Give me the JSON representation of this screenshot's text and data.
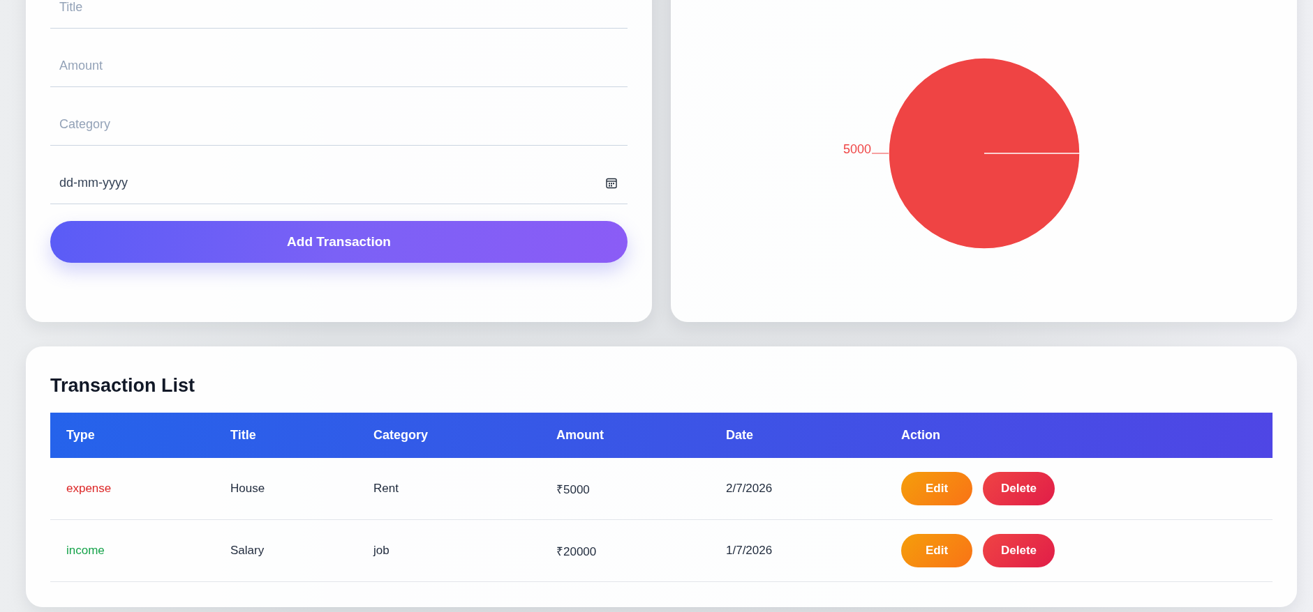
{
  "form": {
    "fields": [
      {
        "kind": "text",
        "placeholder": "Title"
      },
      {
        "kind": "text",
        "placeholder": "Amount"
      },
      {
        "kind": "text",
        "placeholder": "Category"
      },
      {
        "kind": "date",
        "placeholder": "dd-mm-yyyy"
      }
    ],
    "submit": "Add Transaction"
  },
  "chart": {
    "chart_data": {
      "type": "pie",
      "series": [
        {
          "color": "#ef4444",
          "values": [
            5000
          ]
        }
      ],
      "data_labels": true
    }
  },
  "table": {
    "title": "Transaction List",
    "columns": [
      "Type",
      "Title",
      "Category",
      "Amount",
      "Date",
      "Action"
    ],
    "rows": [
      {
        "type": "expense",
        "color": "#dc2626",
        "title": "House",
        "category": "Rent",
        "amount": "₹5000",
        "date": "2/7/2026",
        "actions": [
          {
            "kind": "edit",
            "label": "Edit"
          },
          {
            "kind": "delete",
            "label": "Delete"
          }
        ]
      },
      {
        "type": "income",
        "color": "#16a34a",
        "title": "Salary",
        "category": "job",
        "amount": "₹20000",
        "date": "1/7/2026",
        "actions": [
          {
            "kind": "edit",
            "label": "Edit"
          },
          {
            "kind": "delete",
            "label": "Delete"
          }
        ]
      }
    ]
  }
}
